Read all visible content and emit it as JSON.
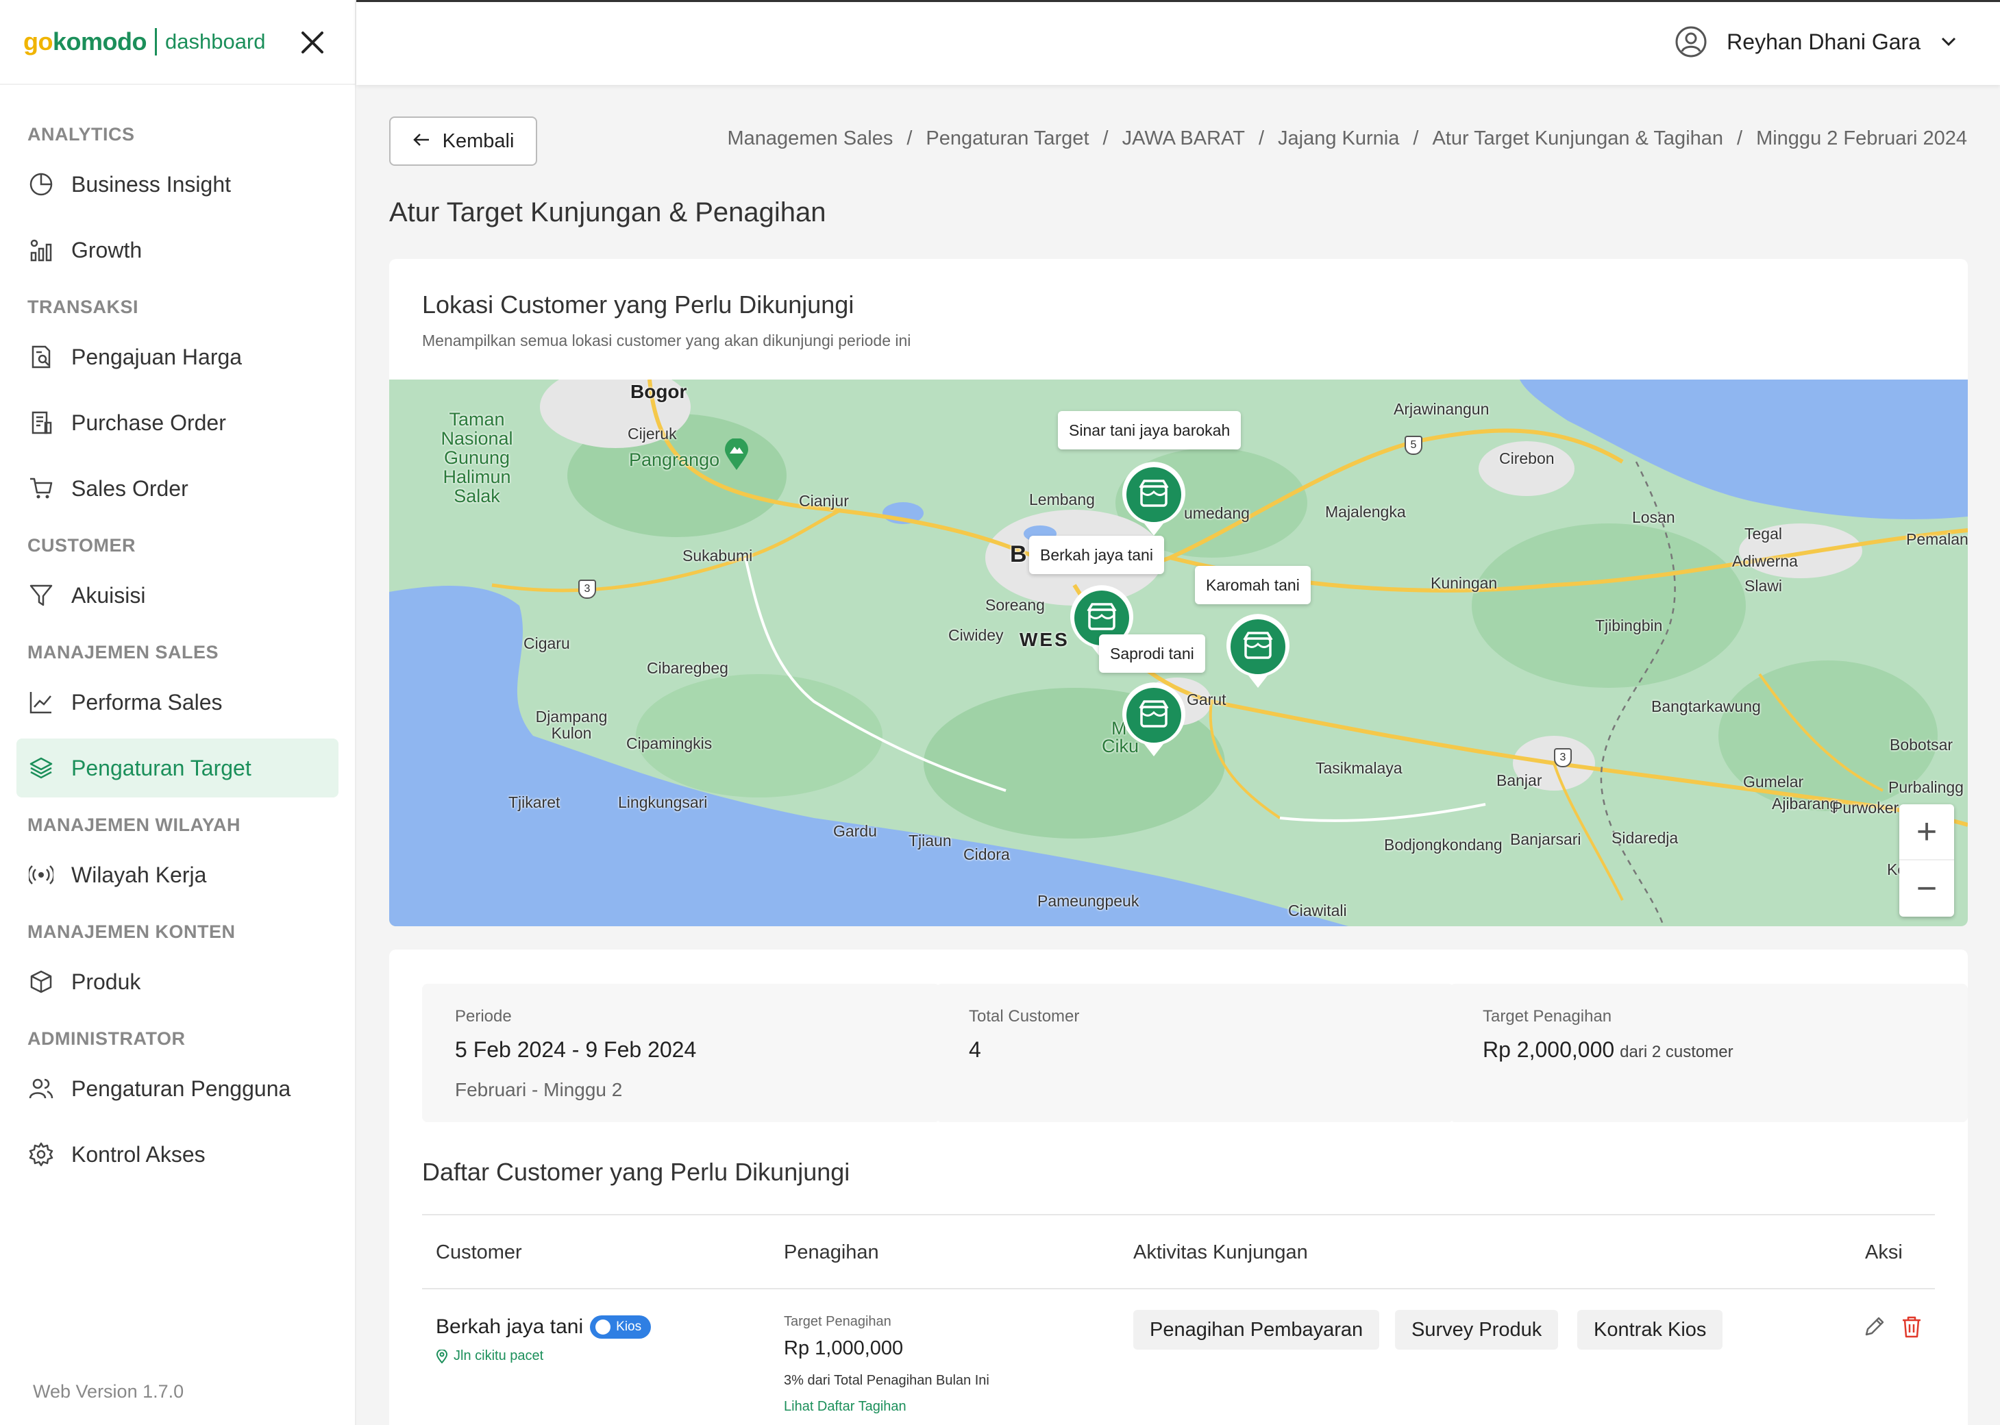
{
  "brand": {
    "logo_part1": "go",
    "logo_part2": "komodo",
    "logo_suffix": "dashboard"
  },
  "sidebar": {
    "groups": [
      {
        "label": "ANALYTICS",
        "items": [
          {
            "label": "Business Insight",
            "icon": "pie-chart-icon"
          },
          {
            "label": "Growth",
            "icon": "growth-chart-icon"
          }
        ]
      },
      {
        "label": "TRANSAKSI",
        "items": [
          {
            "label": "Pengajuan Harga",
            "icon": "price-doc-icon"
          },
          {
            "label": "Purchase Order",
            "icon": "invoice-icon"
          },
          {
            "label": "Sales Order",
            "icon": "cart-icon"
          }
        ]
      },
      {
        "label": "CUSTOMER",
        "items": [
          {
            "label": "Akuisisi",
            "icon": "funnel-icon"
          }
        ]
      },
      {
        "label": "MANAJEMEN SALES",
        "items": [
          {
            "label": "Performa Sales",
            "icon": "line-chart-icon"
          },
          {
            "label": "Pengaturan Target",
            "icon": "layers-icon",
            "active": true
          }
        ]
      },
      {
        "label": "MANAJEMEN WILAYAH",
        "items": [
          {
            "label": "Wilayah Kerja",
            "icon": "broadcast-icon"
          }
        ]
      },
      {
        "label": "MANAJEMEN KONTEN",
        "items": [
          {
            "label": "Produk",
            "icon": "box-icon"
          }
        ]
      },
      {
        "label": "ADMINISTRATOR",
        "items": [
          {
            "label": "Pengaturan Pengguna",
            "icon": "users-icon"
          },
          {
            "label": "Kontrol Akses",
            "icon": "gear-icon"
          }
        ]
      }
    ],
    "version": "Web Version 1.7.0"
  },
  "header": {
    "user_name": "Reyhan Dhani Gara"
  },
  "back_label": "Kembali",
  "breadcrumb": [
    "Managemen Sales",
    "Pengaturan Target",
    "JAWA BARAT",
    "Jajang Kurnia",
    "Atur Target Kunjungan & Tagihan",
    "Minggu 2 Februari 2024"
  ],
  "page_title": "Atur Target Kunjungan & Penagihan",
  "map_card": {
    "title": "Lokasi Customer yang Perlu Dikunjungi",
    "subtitle": "Menampilkan semua lokasi customer yang akan dikunjungi periode ini",
    "places": {
      "bogor": "Bogor",
      "park": "Taman Nasional Gunung Halimun Salak",
      "cijeruk": "Cijeruk",
      "pangrango": "Pangrango",
      "cianjur": "Cianjur",
      "sukabumi": "Sukabumi",
      "lembang": "Lembang",
      "sumedang": "umedang",
      "majalengka": "Majalengka",
      "arjawinangun": "Arjawinangun",
      "cirebon": "Cirebon",
      "losan": "Losan",
      "tegal": "Tegal",
      "adiwerna": "Adiwerna",
      "slawi": "Slawi",
      "pemalang": "Pemalan",
      "kuningan": "Kuningan",
      "tjibingbin": "Tjibingbin",
      "soreang": "Soreang",
      "ciwidey": "Ciwidey",
      "wes": "WES",
      "b": "B",
      "garut": "Garut",
      "cikur": "Ciku",
      "cikur_m": "M",
      "cigaru": "Cigaru",
      "cibaregbeg": "Cibaregbeg",
      "djampang": "Djampang Kulon",
      "cipamingkis": "Cipamingkis",
      "tjikaret": "Tjikaret",
      "lingkungsari": "Lingkungsari",
      "gardu": "Gardu",
      "tjiaun": "Tjiaun",
      "cidora": "Cidora",
      "pameungpeuk": "Pameungpeuk",
      "tasikmalaya": "Tasikmalaya",
      "banjar": "Banjar",
      "bangtarkawung": "Bangtarkawung",
      "bobotsar": "Bobotsar",
      "gumelar": "Gumelar",
      "ajibarang": "Ajibarang",
      "purwoker": "Purwoker",
      "purbalingg": "Purbalingg",
      "kebasen": "Kebasen",
      "bodjong": "Bodjongkondang",
      "banjarsari": "Banjarsari",
      "sidaredja": "Sidaredja",
      "ciawitali": "Ciawitali"
    },
    "road_labels": {
      "r3a": "3",
      "r5": "5",
      "r3b": "3"
    },
    "pins": [
      {
        "name": "Sinar tani jaya barokah"
      },
      {
        "name": "Berkah jaya tani"
      },
      {
        "name": "Karomah tani"
      },
      {
        "name": "Saprodi tani"
      }
    ],
    "zoom_in": "+",
    "zoom_out": "−"
  },
  "stats": {
    "periode": {
      "label": "Periode",
      "value": "5 Feb 2024 - 9 Feb 2024",
      "sub": "Februari - Minggu 2"
    },
    "total_customer": {
      "label": "Total Customer",
      "value": "4"
    },
    "target": {
      "label": "Target Penagihan",
      "value": "Rp 2,000,000",
      "sub": "dari 2 customer"
    }
  },
  "list": {
    "title": "Daftar Customer yang Perlu Dikunjungi",
    "columns": [
      "Customer",
      "Penagihan",
      "Aktivitas Kunjungan",
      "Aksi"
    ],
    "rows": [
      {
        "customer": "Berkah jaya tani",
        "badge": "Kios",
        "address": "Jln cikitu pacet",
        "target_label": "Target Penagihan",
        "target_value": "Rp 1,000,000",
        "target_pct": "3% dari Total Penagihan Bulan Ini",
        "target_link": "Lihat Daftar Tagihan",
        "activities": [
          "Penagihan Pembayaran",
          "Survey Produk",
          "Kontrak Kios"
        ]
      }
    ]
  },
  "colors": {
    "brand_green": "#1b8f5a",
    "brand_yellow": "#f0b400",
    "badge_blue": "#2f7fe3",
    "delete_red": "#e0392b"
  }
}
